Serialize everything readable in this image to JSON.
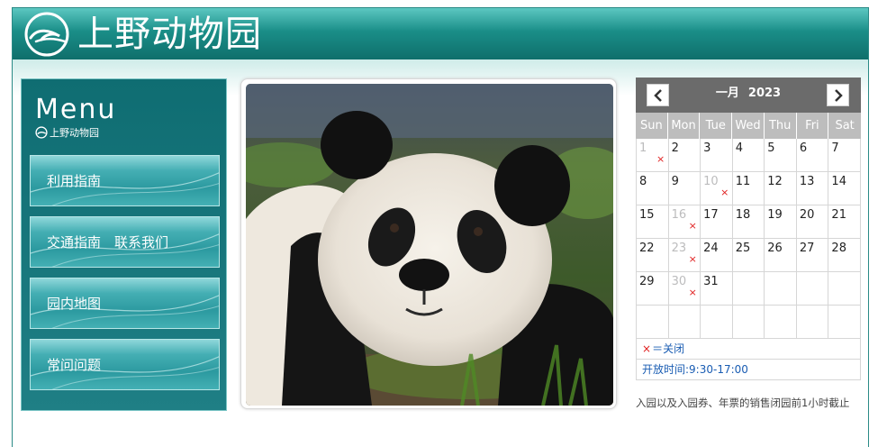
{
  "header": {
    "title": "上野动物园",
    "logo_icon": "ueno-logo-icon"
  },
  "menu": {
    "title": "Menu",
    "subtitle": "上野动物园",
    "items": [
      {
        "label": "利用指南"
      },
      {
        "label": "交通指南　联系我们"
      },
      {
        "label": "园内地图"
      },
      {
        "label": "常问问题"
      }
    ]
  },
  "photo": {
    "subject": "giant-panda-photo"
  },
  "calendar": {
    "month": "一月",
    "year": "2023",
    "prev_icon": "chevron-left-icon",
    "next_icon": "chevron-right-icon",
    "weekdays": [
      "Sun",
      "Mon",
      "Tue",
      "Wed",
      "Thu",
      "Fri",
      "Sat"
    ],
    "weeks": [
      [
        {
          "d": "1",
          "closed": true
        },
        {
          "d": "2"
        },
        {
          "d": "3"
        },
        {
          "d": "4"
        },
        {
          "d": "5"
        },
        {
          "d": "6"
        },
        {
          "d": "7"
        }
      ],
      [
        {
          "d": "8"
        },
        {
          "d": "9"
        },
        {
          "d": "10",
          "closed": true
        },
        {
          "d": "11"
        },
        {
          "d": "12"
        },
        {
          "d": "13"
        },
        {
          "d": "14"
        }
      ],
      [
        {
          "d": "15"
        },
        {
          "d": "16",
          "closed": true
        },
        {
          "d": "17"
        },
        {
          "d": "18"
        },
        {
          "d": "19"
        },
        {
          "d": "20"
        },
        {
          "d": "21"
        }
      ],
      [
        {
          "d": "22"
        },
        {
          "d": "23",
          "closed": true
        },
        {
          "d": "24"
        },
        {
          "d": "25"
        },
        {
          "d": "26"
        },
        {
          "d": "27"
        },
        {
          "d": "28"
        }
      ],
      [
        {
          "d": "29"
        },
        {
          "d": "30",
          "closed": true
        },
        {
          "d": "31"
        },
        {
          "d": ""
        },
        {
          "d": ""
        },
        {
          "d": ""
        },
        {
          "d": ""
        }
      ],
      [
        {
          "d": ""
        },
        {
          "d": ""
        },
        {
          "d": ""
        },
        {
          "d": ""
        },
        {
          "d": ""
        },
        {
          "d": ""
        },
        {
          "d": ""
        }
      ]
    ],
    "closed_mark": "×",
    "legend": "＝关闭",
    "hours": "开放时间:9:30-17:00",
    "note": "入园以及入园券、年票的销售闭园前1小时截止"
  },
  "colors": {
    "header_top": "#5cc7c1",
    "header_bottom": "#0f6f6b",
    "menu_bg": "#0f6d72",
    "menu_button": "#2c9aa0",
    "calendar_head": "#6b6b6b",
    "weekday_bg": "#bdbdbd",
    "closed_mark": "#e02020",
    "link_blue": "#1a5db3"
  }
}
